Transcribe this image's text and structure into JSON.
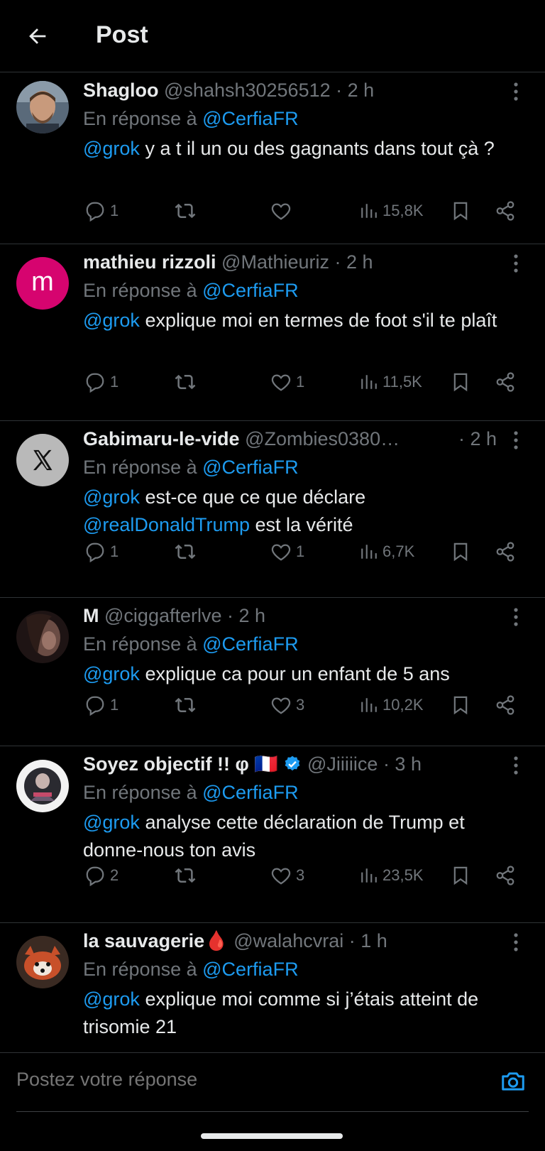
{
  "header": {
    "title": "Post"
  },
  "reply_prefix": "En réponse à",
  "tweets": [
    {
      "name": "Shagloo",
      "handle": "@shahsh30256512",
      "time": "· 2 h",
      "reply_to": "@CerfiaFR",
      "mention": "@grok",
      "text": " y a t il un ou des gagnants dans tout çà ?",
      "replies": "1",
      "retweets": "",
      "likes": "",
      "views": "15,8K"
    },
    {
      "name": "mathieu rizzoli",
      "handle": "@Mathieuriz",
      "time": "· 2 h",
      "avatar_letter": "m",
      "reply_to": "@CerfiaFR",
      "mention": "@grok",
      "text": " explique moi en termes de foot s'il te plaît",
      "replies": "1",
      "retweets": "",
      "likes": "1",
      "views": "11,5K"
    },
    {
      "name": "Gabimaru-le-vide",
      "handle": "@Zombies0380…",
      "time": "· 2 h",
      "reply_to": "@CerfiaFR",
      "mention": "@grok",
      "text": " est-ce que ce que déclare ",
      "mention2": "@realDonaldTrump",
      "text2": " est la vérité",
      "replies": "1",
      "retweets": "",
      "likes": "1",
      "views": "6,7K"
    },
    {
      "name": "M",
      "handle": "@ciggafterlve",
      "time": "· 2 h",
      "reply_to": "@CerfiaFR",
      "mention": "@grok",
      "text": " explique ca pour un enfant de 5 ans",
      "replies": "1",
      "retweets": "",
      "likes": "3",
      "views": "10,2K"
    },
    {
      "name": "Soyez objectif !! φ 🇫🇷",
      "handle": "@Jiiiiice",
      "time": "· 3 h",
      "verified": true,
      "reply_to": "@CerfiaFR",
      "mention": "@grok",
      "text": " analyse cette déclaration de Trump et donne-nous ton avis",
      "replies": "2",
      "retweets": "",
      "likes": "3",
      "views": "23,5K"
    },
    {
      "name": "la sauvagerie🩸",
      "handle": "@walahcvrai",
      "time": "· 1 h",
      "reply_to": "@CerfiaFR",
      "mention": "@grok",
      "text": " explique moi comme si j’étais atteint de trisomie 21"
    }
  ],
  "reply_bar": {
    "placeholder": "Postez votre réponse"
  },
  "colors": {
    "accent": "#1d9bf0",
    "muted": "#71767b",
    "text": "#e7e9ea",
    "divider": "#2f3336",
    "avatar_pink": "#d6046f"
  },
  "icons": [
    "back-arrow-icon",
    "more-vertical-icon",
    "reply-icon",
    "retweet-icon",
    "like-icon",
    "views-icon",
    "bookmark-icon",
    "share-icon",
    "verified-icon",
    "camera-icon"
  ]
}
